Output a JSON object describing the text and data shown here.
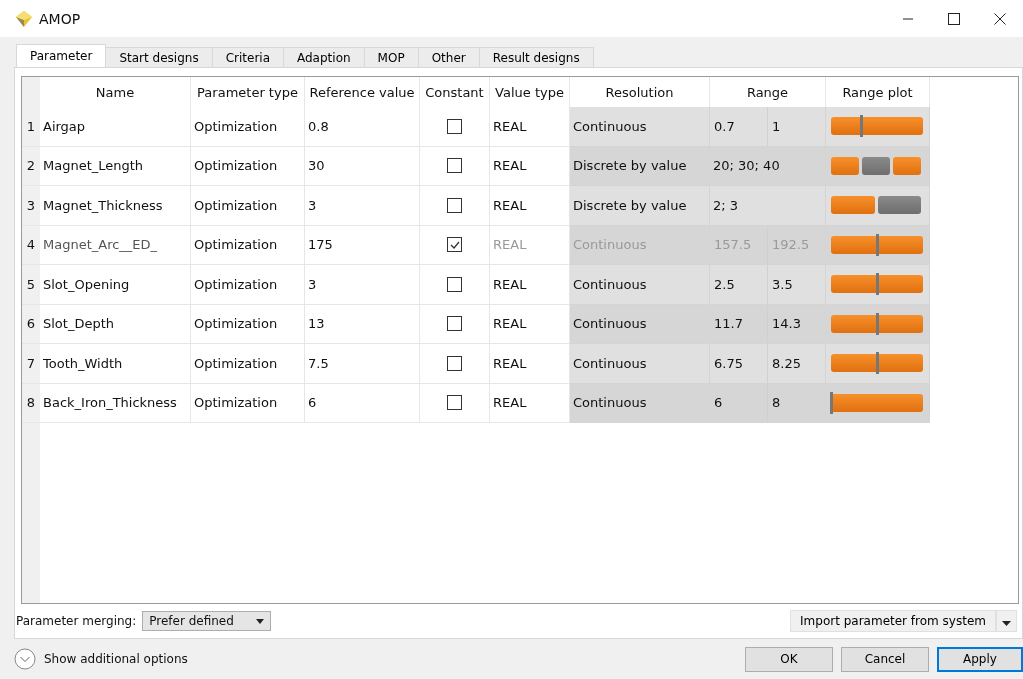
{
  "window": {
    "title": "AMOP"
  },
  "tabs": [
    {
      "label": "Parameter",
      "selected": true
    },
    {
      "label": "Start designs",
      "selected": false
    },
    {
      "label": "Criteria",
      "selected": false
    },
    {
      "label": "Adaption",
      "selected": false
    },
    {
      "label": "MOP",
      "selected": false
    },
    {
      "label": "Other",
      "selected": false
    },
    {
      "label": "Result designs",
      "selected": false
    }
  ],
  "table": {
    "columns": [
      "Name",
      "Parameter type",
      "Reference value",
      "Constant",
      "Value type",
      "Resolution",
      "Range",
      "Range plot"
    ],
    "rows": [
      {
        "index": "1",
        "name": "Airgap",
        "type": "Optimization",
        "reference": "0.8",
        "constant": false,
        "value_type": "REAL",
        "resolution": "Continuous",
        "kind": "continuous",
        "range_min": "0.7",
        "range_max": "1",
        "level": 0.33
      },
      {
        "index": "2",
        "name": "Magnet_Length",
        "type": "Optimization",
        "reference": "30",
        "constant": false,
        "value_type": "REAL",
        "resolution": "Discrete by value",
        "kind": "discrete",
        "values": "20; 30; 40",
        "segments": [
          {
            "selected": false
          },
          {
            "selected": true
          },
          {
            "selected": false
          }
        ]
      },
      {
        "index": "3",
        "name": "Magnet_Thickness",
        "type": "Optimization",
        "reference": "3",
        "constant": false,
        "value_type": "REAL",
        "resolution": "Discrete by value",
        "kind": "discrete",
        "values": "2; 3",
        "segments": [
          {
            "selected": false
          },
          {
            "selected": true
          }
        ]
      },
      {
        "index": "4",
        "name": "Magnet_Arc__ED_",
        "type": "Optimization",
        "reference": "175",
        "constant": true,
        "value_type": "REAL",
        "resolution": "Continuous",
        "kind": "continuous",
        "range_min": "157.5",
        "range_max": "192.5",
        "level": 0.5
      },
      {
        "index": "5",
        "name": "Slot_Opening",
        "type": "Optimization",
        "reference": "3",
        "constant": false,
        "value_type": "REAL",
        "resolution": "Continuous",
        "kind": "continuous",
        "range_min": "2.5",
        "range_max": "3.5",
        "level": 0.5
      },
      {
        "index": "6",
        "name": "Slot_Depth",
        "type": "Optimization",
        "reference": "13",
        "constant": false,
        "value_type": "REAL",
        "resolution": "Continuous",
        "kind": "continuous",
        "range_min": "11.7",
        "range_max": "14.3",
        "level": 0.5
      },
      {
        "index": "7",
        "name": "Tooth_Width",
        "type": "Optimization",
        "reference": "7.5",
        "constant": false,
        "value_type": "REAL",
        "resolution": "Continuous",
        "kind": "continuous",
        "range_min": "6.75",
        "range_max": "8.25",
        "level": 0.5
      },
      {
        "index": "8",
        "name": "Back_Iron_Thickness",
        "type": "Optimization",
        "reference": "6",
        "constant": false,
        "value_type": "REAL",
        "resolution": "Continuous",
        "kind": "continuous",
        "range_min": "6",
        "range_max": "8",
        "level": 0
      }
    ]
  },
  "merging": {
    "label": "Parameter merging:",
    "value": "Prefer defined"
  },
  "import_button": "Import parameter from system",
  "options_toggle": "Show additional options",
  "buttons": [
    "OK",
    "Cancel",
    "Apply"
  ]
}
